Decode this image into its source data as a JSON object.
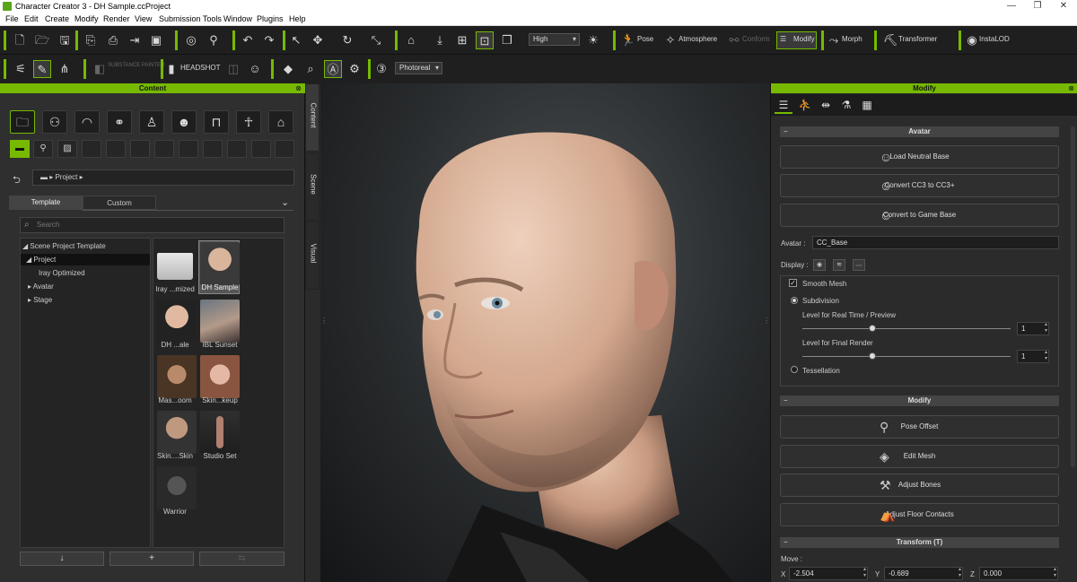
{
  "window": {
    "title": "Character Creator 3 - DH Sample.ccProject"
  },
  "menu": [
    "File",
    "Edit",
    "Create",
    "Modify",
    "Render",
    "View",
    "Submission Tools",
    "Window",
    "Plugins",
    "Help"
  ],
  "toolbar1": {
    "quality": "High",
    "pose": "Pose",
    "atmosphere": "Atmosphere",
    "conform": "Conform",
    "modify": "Modify",
    "morph": "Morph",
    "transformer": "Transformer",
    "instalod": "InstaLOD"
  },
  "toolbar2": {
    "substance": "SUBSTANCE PAINTER",
    "headshot": "HEADSHOT",
    "render_mode": "Photoreal"
  },
  "content": {
    "title": "Content",
    "breadcrumb": "Project",
    "tabs": [
      "Template",
      "Custom"
    ],
    "search_placeholder": "Search",
    "tree": [
      "Scene Project Template",
      "Project",
      "Iray Optimized",
      "Avatar",
      "Stage"
    ],
    "items": [
      "Iray ...mized",
      "DH Sample",
      "DH ...ale",
      "IBL Sunset",
      "Mas...oom",
      "Skin...keup",
      "Skin....Skin",
      "Studio Set",
      "Warrior"
    ],
    "side_tabs": [
      "Content",
      "Scene",
      "Visual"
    ]
  },
  "modify": {
    "title": "Modify",
    "avatar_section": "Avatar",
    "load_neutral": "Load Neutral Base",
    "convert_cc3": "Convert CC3 to CC3+",
    "convert_game": "Convert to Game Base",
    "avatar_label": "Avatar :",
    "avatar_value": "CC_Base",
    "display_label": "Display :",
    "smooth_mesh": "Smooth Mesh",
    "subdivision": "Subdivision",
    "level_realtime": "Level for Real Time / Preview",
    "level_realtime_value": "1",
    "level_final": "Level for Final Render",
    "level_final_value": "1",
    "tessellation": "Tessellation",
    "modify_section": "Modify",
    "pose_offset": "Pose Offset",
    "edit_mesh": "Edit Mesh",
    "adjust_bones": "Adjust Bones",
    "adjust_floor": "Adjust Floor Contacts",
    "transform_section": "Transform  (T)",
    "move_label": "Move :",
    "x_label": "X",
    "x_value": "-2.504",
    "y_label": "Y",
    "y_value": "-0.689",
    "z_label": "Z",
    "z_value": "0.000"
  },
  "colors": {
    "accent": "#76b900"
  }
}
